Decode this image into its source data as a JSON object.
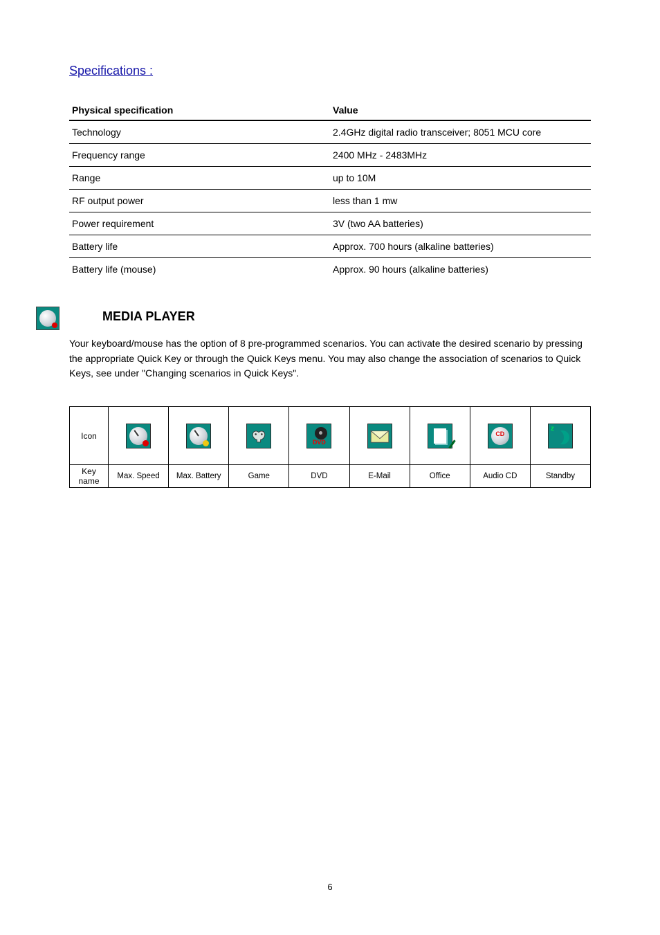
{
  "heading_link": "Specifications :",
  "spec_header": {
    "col_a": "Physical specification",
    "col_b": "Value"
  },
  "spec_rows": [
    {
      "a": "Technology",
      "b": "2.4GHz digital radio transceiver; 8051 MCU core"
    },
    {
      "a": "Frequency range",
      "b": "2400 MHz - 2483MHz"
    },
    {
      "a": "Range",
      "b": "up to 10M"
    },
    {
      "a": "RF output power",
      "b": "less than 1 mw"
    },
    {
      "a": "Power requirement",
      "b": "3V (two AA batteries)"
    },
    {
      "a": "Battery life",
      "b": "Approx. 700 hours (alkaline batteries)"
    },
    {
      "a": "Battery life (mouse)",
      "b": "Approx. 90 hours (alkaline batteries)"
    }
  ],
  "section2": {
    "title": "MEDIA PLAYER",
    "paragraph": "Your keyboard/mouse has the option of 8 pre-programmed scenarios. You can activate the desired scenario by pressing the appropriate Quick Key or through the Quick Keys menu. You may also change the association of scenarios to Quick Keys, see under \"Changing scenarios in Quick Keys\"."
  },
  "icon_table": {
    "row_icons_label": "Icon",
    "row_labels_label": "Key name",
    "cells": [
      {
        "name": "max-speed-icon",
        "label": "Max. Speed"
      },
      {
        "name": "max-battery-icon",
        "label": "Max. Battery"
      },
      {
        "name": "game-icon",
        "label": "Game"
      },
      {
        "name": "dvd-icon",
        "label": "DVD",
        "badge_text": "DVD"
      },
      {
        "name": "email-icon",
        "label": "E-Mail"
      },
      {
        "name": "office-icon",
        "label": "Office"
      },
      {
        "name": "audio-cd-icon",
        "label": "Audio CD",
        "badge_text": "CD"
      },
      {
        "name": "standby-icon",
        "label": "Standby"
      }
    ]
  },
  "page_number": "6"
}
